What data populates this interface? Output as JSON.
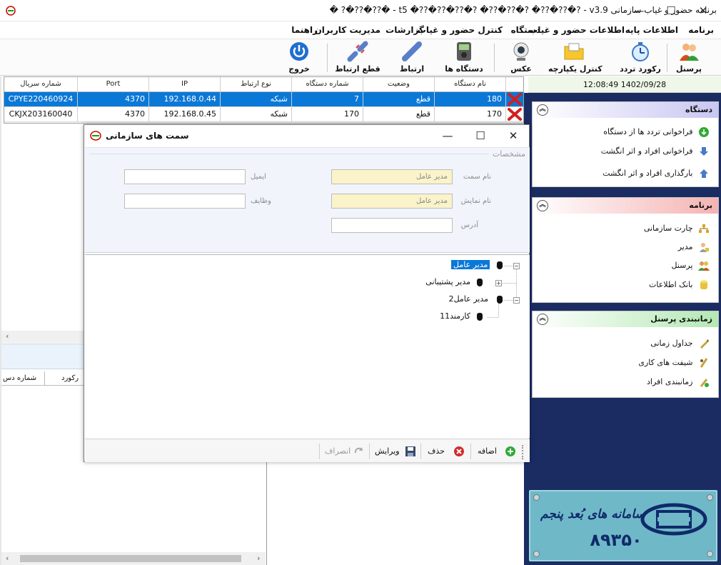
{
  "window": {
    "title": "برنامه حضور و غیاب سازمانی t5 �??�??�??�? �??�??�? �??�??�? - v3.9 - �??�??�? �",
    "min_glyph": "—",
    "max_glyph": "☐",
    "close_glyph": "✕"
  },
  "menu": {
    "items": [
      "برنامه",
      "اطلاعات پایه",
      "اطلاعات حضور و غیاب",
      "دستگاه",
      "کنترل حضور و غیاب",
      "گزارشات",
      "مدیریت کاربران",
      "راهنما"
    ]
  },
  "toolbar": {
    "personnel": "پرسنل",
    "record": "رکورد تردد",
    "control": "کنترل یکپارچه",
    "photo": "عکس",
    "devices": "دستگاه ها",
    "connect": "ارتباط",
    "disconnect": "قطع ارتباط",
    "exit": "خروج"
  },
  "status": {
    "datetime": "12:08:49 1402/09/28"
  },
  "device_grid": {
    "columns": {
      "name": "نام دستگاه",
      "status": "وضعیت",
      "number": "شماره دستگاه",
      "conn_type": "نوع ارتباط",
      "ip": "IP",
      "port": "Port",
      "serial": "شماره سریال"
    },
    "rows": [
      {
        "name": "180",
        "status": "قطع",
        "number": "7",
        "conn_type": "شبکه",
        "ip": "192.168.0.44",
        "port": "4370",
        "serial": "CPYE220460924"
      },
      {
        "name": "170",
        "status": "قطع",
        "number": "170",
        "conn_type": "شبکه",
        "ip": "192.168.0.45",
        "port": "4370",
        "serial": "CKJX203160040"
      }
    ]
  },
  "lower_grid": {
    "col_record": "رکورد",
    "col_device": "شماره دس"
  },
  "right_panel": {
    "device_section": {
      "title": "دستگاه",
      "items": [
        "فراخوانی تردد ها از دستگاه",
        "فراخوانی افراد و اثر انگشت",
        "بارگذاری افراد و اثر انگشت"
      ]
    },
    "program_section": {
      "title": "برنامه",
      "items": [
        "چارت سازمانی",
        "مدیر",
        "پرسنل",
        "بانک اطلاعات"
      ]
    },
    "schedule_section": {
      "title": "زمانبندی پرسنل",
      "items": [
        "جداول زمانی",
        "شیفت های کاری",
        "زمانبندی افراد"
      ]
    },
    "collapse_glyph": "︽"
  },
  "dialog": {
    "title": "سمت های سازمانی",
    "group_label": "مشخصات",
    "fields": {
      "position_name_label": "نام سمت",
      "position_name_value": "مدیر عامل",
      "display_name_label": "نام نمایش",
      "display_name_value": "مدیر عامل",
      "address_label": "آدرس",
      "address_value": "",
      "email_label": "ایمیل",
      "email_value": "",
      "duties_label": "وظایف",
      "duties_value": ""
    },
    "tree": {
      "nodes": [
        "مدیر عامل",
        "مدیر پشتیبانی",
        "مدیر عامل2",
        "کارمند11"
      ],
      "minus_glyph": "−",
      "plus_glyph": "+"
    },
    "footer": {
      "add": "اضافه",
      "delete": "حذف",
      "edit": "ویرایش",
      "cancel": "انصراف"
    }
  },
  "logo": {
    "text": "سامانه های بُعد پنجم",
    "number": "۸۹۳۵۰"
  },
  "colors": {
    "selection": "#0a78d7",
    "right_panel_bg": "#1a2c62",
    "device_header": "#c9c6f2",
    "program_header": "#f5b3b3",
    "schedule_header": "#b3e8b3",
    "required_field": "#fbf3c9"
  }
}
